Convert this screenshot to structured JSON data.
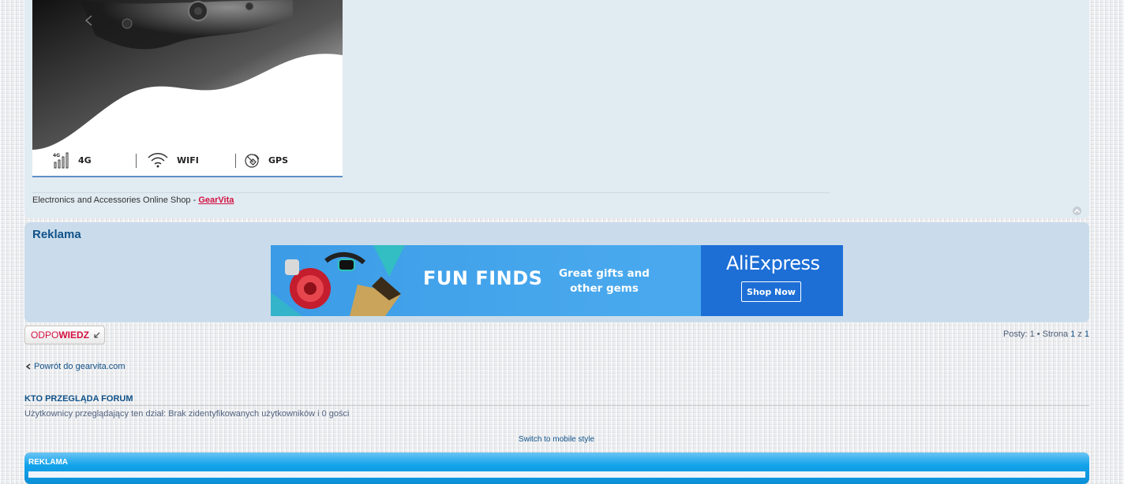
{
  "post": {
    "product_specs": [
      {
        "icon": "signal-4g-icon",
        "label": "4G"
      },
      {
        "icon": "wifi-icon",
        "label": "WIFI"
      },
      {
        "icon": "gps-icon",
        "label": "GPS"
      }
    ],
    "signature_text": "Electronics and Accessories Online Shop - ",
    "signature_link": "GearVita"
  },
  "reklama": {
    "title": "Reklama",
    "ad": {
      "headline": "FUN FINDS",
      "subline": "Great gifts and other gems",
      "brand": "AliExpress",
      "button": "Shop Now"
    }
  },
  "actions": {
    "reply_part1": "ODPO",
    "reply_part2": "WIEDZ"
  },
  "pagination": {
    "posts_label": "Posty: ",
    "posts_count": "1",
    "bullet": " • ",
    "page_label": "Strona ",
    "page_current": "1",
    "page_of": " z ",
    "page_total": "1"
  },
  "back_link": "Powrót do gearvita.com",
  "who_is_online": {
    "title": "KTO PRZEGLĄDA FORUM",
    "text": "Użytkownicy przeglądający ten dział: Brak zidentyfikowanych użytkowników i 0 gości"
  },
  "mobile_style_link": "Switch to mobile style",
  "footer_reklama": {
    "title": "REKLAMA"
  },
  "colors": {
    "link": "#105289",
    "accent": "#d31141",
    "panel": "#e1ebf2",
    "ad_panel": "#cadceb",
    "footer_bar": "#12a3eb"
  }
}
